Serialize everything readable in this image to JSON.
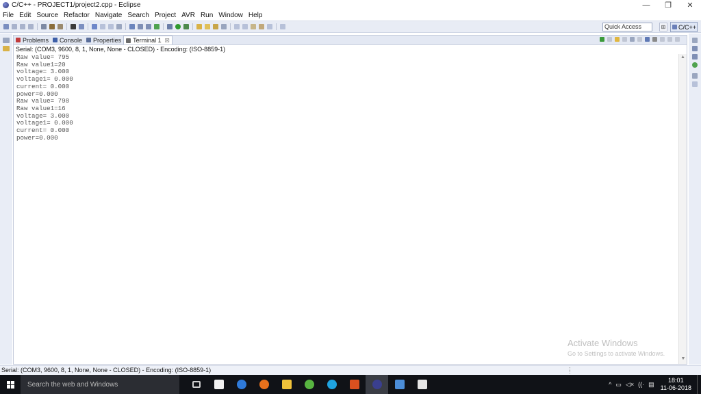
{
  "window": {
    "title": "C/C++ - PROJECT1/project2.cpp - Eclipse",
    "minimize": "—",
    "restore": "❐",
    "close": "✕"
  },
  "menu": [
    "File",
    "Edit",
    "Source",
    "Refactor",
    "Navigate",
    "Search",
    "Project",
    "AVR",
    "Run",
    "Window",
    "Help"
  ],
  "toolbar": {
    "quick_access": "Quick Access",
    "perspective": "C/C++"
  },
  "view": {
    "tabs": [
      {
        "label": "Problems",
        "color": "#c23b3b"
      },
      {
        "label": "Console",
        "color": "#3d5fa8"
      },
      {
        "label": "Properties",
        "color": "#5a6e9a"
      },
      {
        "label": "Terminal 1",
        "color": "#6b6b6b",
        "active": true
      }
    ],
    "close_glyph": "☒",
    "terminal_header": "Serial: (COM3, 9600, 8, 1, None, None - CLOSED) - Encoding: (ISO-8859-1)",
    "lines": [
      "Raw value= 795",
      "Raw value1=20",
      "voltage= 3.000",
      "voltage1= 0.000",
      "current= 0.000",
      "power=0.000",
      "Raw value= 798",
      "Raw value1=16",
      "voltage= 3.000",
      "voltage1= 0.000",
      "current= 0.000",
      "power=0.000"
    ]
  },
  "watermark": {
    "line1": "Activate Windows",
    "line2": "Go to Settings to activate Windows."
  },
  "statusbar": {
    "text": "Serial: (COM3, 9600, 8, 1, None, None - CLOSED) - Encoding: (ISO-8859-1)"
  },
  "taskbar": {
    "search_placeholder": "Search the web and Windows",
    "apps": [
      {
        "name": "task-view-icon",
        "color": "#cfcfcf"
      },
      {
        "name": "store-icon",
        "color": "#f2f2f2"
      },
      {
        "name": "edge-icon",
        "color": "#2f7ad9"
      },
      {
        "name": "firefox-icon",
        "color": "#e8711c"
      },
      {
        "name": "file-explorer-icon",
        "color": "#f0c23a"
      },
      {
        "name": "utorrent-icon",
        "color": "#57b340"
      },
      {
        "name": "skype-icon",
        "color": "#1fa3e0"
      },
      {
        "name": "office-icon",
        "color": "#d9501f"
      },
      {
        "name": "eclipse-icon",
        "color": "#3a3f8f"
      },
      {
        "name": "window-app-icon",
        "color": "#4c8ed9"
      },
      {
        "name": "photos-icon",
        "color": "#e6e6e6"
      }
    ],
    "tray": [
      "^",
      "▭",
      "◁×",
      "((·",
      "▤"
    ],
    "time": "18:01",
    "date": "11-06-2018"
  }
}
